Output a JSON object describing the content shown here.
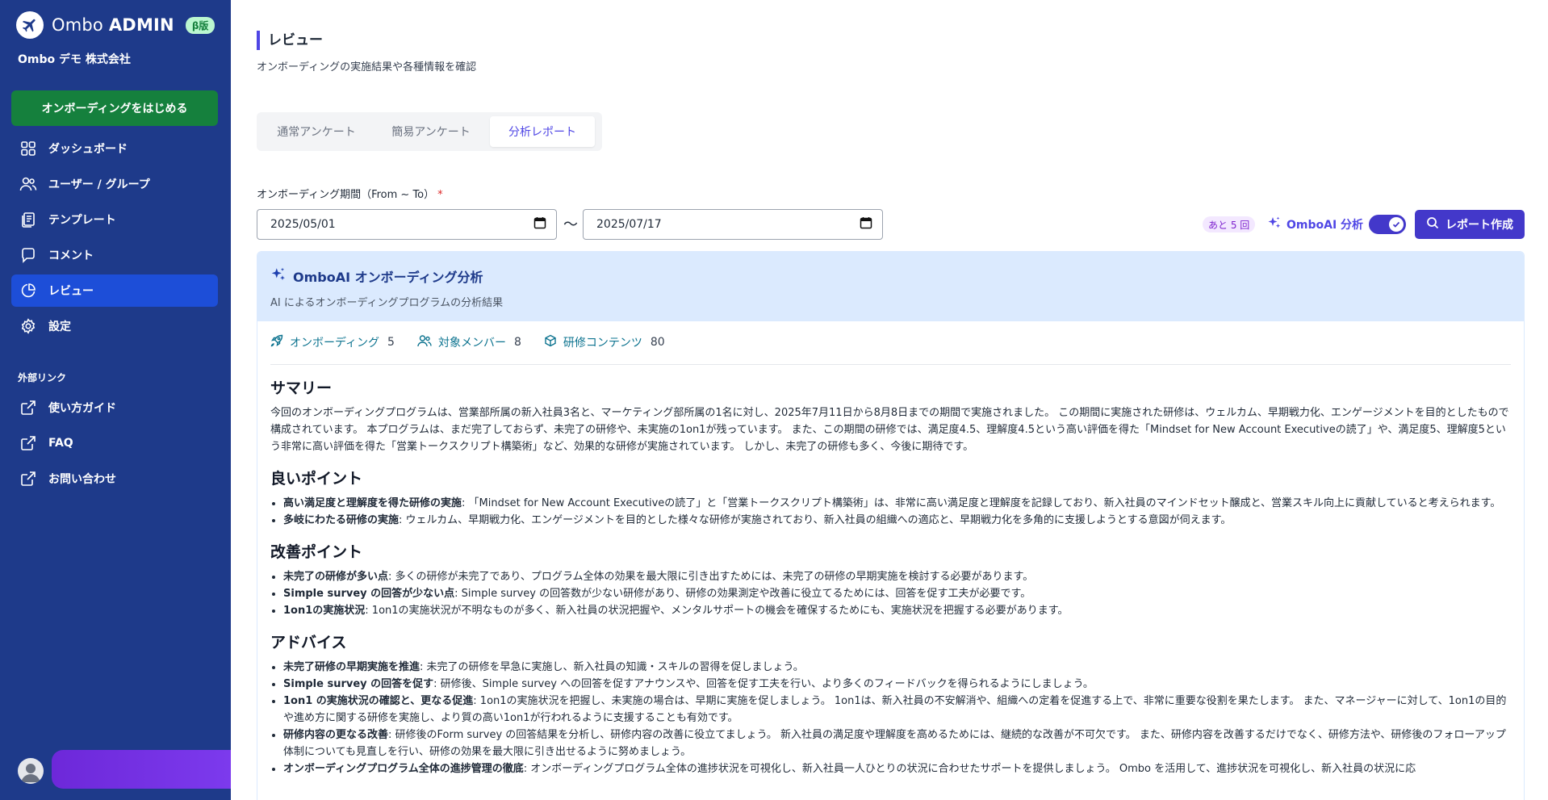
{
  "sidebar": {
    "brand_prefix": "Ombo",
    "brand_suffix": "ADMIN",
    "beta": "β版",
    "company": "Ombo デモ 株式会社",
    "start_button": "オンボーディングをはじめる",
    "nav": [
      {
        "label": "ダッシュボード",
        "icon": "dashboard-icon"
      },
      {
        "label": "ユーザー / グループ",
        "icon": "users-icon"
      },
      {
        "label": "テンプレート",
        "icon": "template-icon"
      },
      {
        "label": "コメント",
        "icon": "comment-icon"
      },
      {
        "label": "レビュー",
        "icon": "pie-chart-icon",
        "active": true
      },
      {
        "label": "設定",
        "icon": "gear-icon"
      }
    ],
    "external_heading": "外部リンク",
    "external": [
      {
        "label": "使い方ガイド",
        "icon": "external-link-icon"
      },
      {
        "label": "FAQ",
        "icon": "external-link-icon"
      },
      {
        "label": "お問い合わせ",
        "icon": "external-link-icon"
      }
    ]
  },
  "page": {
    "title": "レビュー",
    "subtitle": "オンボーディングの実施結果や各種情報を確認"
  },
  "tabs": [
    {
      "label": "通常アンケート",
      "active": false
    },
    {
      "label": "簡易アンケート",
      "active": false
    },
    {
      "label": "分析レポート",
      "active": true
    }
  ],
  "period": {
    "label": "オンボーディング期間（From ~ To）",
    "required_mark": "*",
    "from": "2025/05/01",
    "separator": "〜",
    "to": "2025/07/17"
  },
  "ai": {
    "remaining": "あと 5 回",
    "label": "OmboAI 分析",
    "enabled": true,
    "create_button": "レポート作成"
  },
  "report": {
    "title": "OmboAI オンボーディング分析",
    "subtitle": "AI によるオンボーディングプログラムの分析結果",
    "stats": [
      {
        "label": "オンボーディング",
        "value": "5",
        "icon": "rocket-icon"
      },
      {
        "label": "対象メンバー",
        "value": "8",
        "icon": "members-icon"
      },
      {
        "label": "研修コンテンツ",
        "value": "80",
        "icon": "cube-icon"
      }
    ],
    "summary_heading": "サマリー",
    "summary": "今回のオンボーディングプログラムは、営業部所属の新入社員3名と、マーケティング部所属の1名に対し、2025年7月11日から8月8日までの期間で実施されました。 この期間に実施された研修は、ウェルカム、早期戦力化、エンゲージメントを目的としたもので構成されています。 本プログラムは、まだ完了しておらず、未完了の研修や、未実施の1on1が残っています。 また、この期間の研修では、満足度4.5、理解度4.5という高い評価を得た「Mindset for New Account Executiveの読了」や、満足度5、理解度5という非常に高い評価を得た「営業トークスクリプト構築術」など、効果的な研修が実施されています。 しかし、未完了の研修も多く、今後に期待です。",
    "good_heading": "良いポイント",
    "good": [
      {
        "title": "高い満足度と理解度を得た研修の実施",
        "text": ": 「Mindset for New Account Executiveの読了」と「営業トークスクリプト構築術」は、非常に高い満足度と理解度を記録しており、新入社員のマインドセット醸成と、営業スキル向上に貢献していると考えられます。"
      },
      {
        "title": "多岐にわたる研修の実施",
        "text": ": ウェルカム、早期戦力化、エンゲージメントを目的とした様々な研修が実施されており、新入社員の組織への適応と、早期戦力化を多角的に支援しようとする意図が伺えます。"
      }
    ],
    "improve_heading": "改善ポイント",
    "improve": [
      {
        "title": "未完了の研修が多い点",
        "text": ": 多くの研修が未完了であり、プログラム全体の効果を最大限に引き出すためには、未完了の研修の早期実施を検討する必要があります。"
      },
      {
        "title": "Simple survey の回答が少ない点",
        "text": ": Simple survey の回答数が少ない研修があり、研修の効果測定や改善に役立てるためには、回答を促す工夫が必要です。"
      },
      {
        "title": "1on1の実施状況",
        "text": ": 1on1の実施状況が不明なものが多く、新入社員の状況把握や、メンタルサポートの機会を確保するためにも、実施状況を把握する必要があります。"
      }
    ],
    "advice_heading": "アドバイス",
    "advice": [
      {
        "title": "未完了研修の早期実施を推進",
        "text": ": 未完了の研修を早急に実施し、新入社員の知識・スキルの習得を促しましょう。"
      },
      {
        "title": "Simple survey の回答を促す",
        "text": ": 研修後、Simple survey への回答を促すアナウンスや、回答を促す工夫を行い、より多くのフィードバックを得られるようにしましょう。"
      },
      {
        "title": "1on1 の実施状況の確認と、更なる促進",
        "text": ": 1on1の実施状況を把握し、未実施の場合は、早期に実施を促しましょう。 1on1は、新入社員の不安解消や、組織への定着を促進する上で、非常に重要な役割を果たします。 また、マネージャーに対して、1on1の目的や進め方に関する研修を実施し、より質の高い1on1が行われるように支援することも有効です。"
      },
      {
        "title": "研修内容の更なる改善",
        "text": ": 研修後のForm survey の回答結果を分析し、研修内容の改善に役立てましょう。 新入社員の満足度や理解度を高めるためには、継続的な改善が不可欠です。 また、研修内容を改善するだけでなく、研修方法や、研修後のフォローアップ体制についても見直しを行い、研修の効果を最大限に引き出せるように努めましょう。"
      },
      {
        "title": "オンボーディングプログラム全体の進捗管理の徹底",
        "text": ": オンボーディングプログラム全体の進捗状況を可視化し、新入社員一人ひとりの状況に合わせたサポートを提供しましょう。 Ombo を活用して、進捗状況を可視化し、新入社員の状況に応"
      }
    ]
  },
  "colors": {
    "sidebar_bg": "#1e3a8a",
    "active_nav": "#1d4ed8",
    "start_button": "#15803d",
    "accent": "#4338ca",
    "report_header": "#dbeafe"
  }
}
